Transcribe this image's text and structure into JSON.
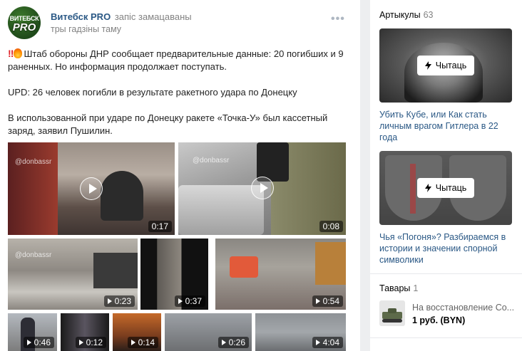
{
  "post": {
    "author": "Витебск PRO",
    "action": "запіс замацаваны",
    "time": "тры гадзіны таму",
    "avatar_line1": "ВИТЕБСК",
    "avatar_line2": "PRO",
    "more_glyph": "•••",
    "paragraphs": [
      "Штаб обороны ДНР сообщает предварительные данные: 20 погибших и 9 раненных. Но информация продолжает поступать.",
      "UPD: 26 человек погибли в результате ракетного удара по Донецку",
      "В использованной при ударе по Донецку ракете «Точка-У» был кассетный заряд, заявил Пушилин."
    ],
    "videos": [
      {
        "duration": "0:17",
        "watermark": "@donbassr"
      },
      {
        "duration": "0:08",
        "watermark": "@donbassr"
      },
      {
        "duration": "0:23",
        "watermark": "@donbassr"
      },
      {
        "duration": "0:37",
        "watermark": ""
      },
      {
        "duration": "0:54",
        "watermark": ""
      },
      {
        "duration": "0:46",
        "watermark": ""
      },
      {
        "duration": "0:12",
        "watermark": ""
      },
      {
        "duration": "0:14",
        "watermark": ""
      },
      {
        "duration": "0:26",
        "watermark": ""
      },
      {
        "duration": "4:04",
        "watermark": ""
      }
    ]
  },
  "sidebar": {
    "articles": {
      "label": "Артыкулы",
      "count": "63",
      "read_label": "Чытаць",
      "items": [
        {
          "title": "Убить Кубе, или Как стать личным врагом Гитлера в 22 года"
        },
        {
          "title": "Чья «Погоня»? Разбираемся в истории и значении спорной символики"
        }
      ]
    },
    "goods": {
      "label": "Тавары",
      "count": "1",
      "item_name": "На восстановление Со...",
      "item_price": "1 руб. (BYN)"
    }
  },
  "colors": {
    "link": "#2a5885",
    "muted": "#828282",
    "background": "#edeef0"
  }
}
